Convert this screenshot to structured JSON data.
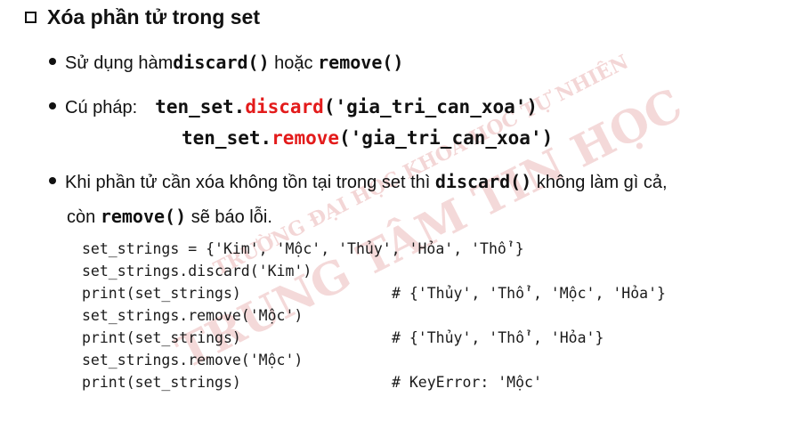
{
  "watermark": {
    "line1": "TRƯỜNG ĐẠI HỌC KHOA HỌC TỰ NHIÊN",
    "line2": "TRUNG TÂM TIN HỌC"
  },
  "title": "Xóa phần tử trong set",
  "bullets": {
    "b1_prefix": "Sử dụng hàm ",
    "b1_code1": "discard()",
    "b1_mid": " hoặc ",
    "b1_code2": "remove()",
    "b2_label": "Cú pháp:",
    "syntax1_a": "ten_set.",
    "syntax1_b": "discard",
    "syntax1_c": "('gia_tri_can_xoa')",
    "syntax2_a": "ten_set.",
    "syntax2_b": "remove",
    "syntax2_c": "('gia_tri_can_xoa')",
    "b3_prefix": "Khi phần tử cần xóa không tồn tại trong set thì ",
    "b3_code": "discard()",
    "b3_suffix": " không làm gì cả,",
    "b3_cont_prefix": "còn ",
    "b3_cont_code": "remove()",
    "b3_cont_suffix": " sẽ báo lỗi."
  },
  "code": {
    "l1": "set_strings = {'Kim', 'Mộc', 'Thủy', 'Hỏa', 'Thổ'}",
    "l2": "set_strings.discard('Kim')",
    "l3": "print(set_strings)",
    "l3c": "# {'Thủy', 'Thổ', 'Mộc', 'Hỏa'}",
    "l4": "set_strings.remove('Mộc')",
    "l5": "print(set_strings)",
    "l5c": "# {'Thủy', 'Thổ', 'Hỏa'}",
    "l6": "set_strings.remove('Mộc')",
    "l7": "print(set_strings)",
    "l7c": "# KeyError: 'Mộc'"
  }
}
